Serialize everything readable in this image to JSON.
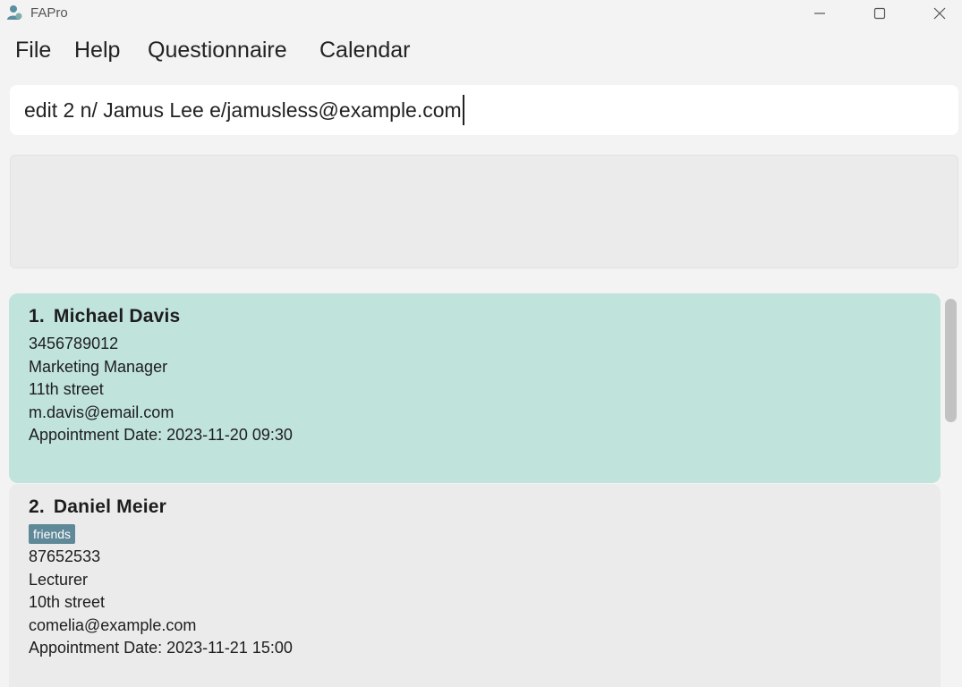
{
  "window": {
    "title": "FAPro",
    "icon": "person-app-icon",
    "controls": [
      "minimize-icon",
      "maximize-icon",
      "close-icon"
    ]
  },
  "menu": {
    "file": "File",
    "help": "Help",
    "questionnaire": "Questionnaire",
    "calendar": "Calendar"
  },
  "command": {
    "value": "edit 2 n/ Jamus Lee e/jamusless@example.com"
  },
  "result": {
    "text": ""
  },
  "persons": [
    {
      "index": "1.",
      "name": "Michael Davis",
      "tags": [],
      "phone": "3456789012",
      "occupation": "Marketing Manager",
      "address": "11th street",
      "email": "m.davis@email.com",
      "appointment": "Appointment Date: 2023-11-20 09:30",
      "selected": true
    },
    {
      "index": "2.",
      "name": "Daniel Meier",
      "tags": [
        "friends"
      ],
      "phone": "87652533",
      "occupation": "Lecturer",
      "address": "10th street",
      "email": "comelia@example.com",
      "appointment": "Appointment Date: 2023-11-21 15:00",
      "selected": false
    }
  ],
  "colors": {
    "selected_card": "#c0e3dc",
    "card": "#ebebeb",
    "tag": "#5f8898",
    "background": "#f3f3f3"
  }
}
